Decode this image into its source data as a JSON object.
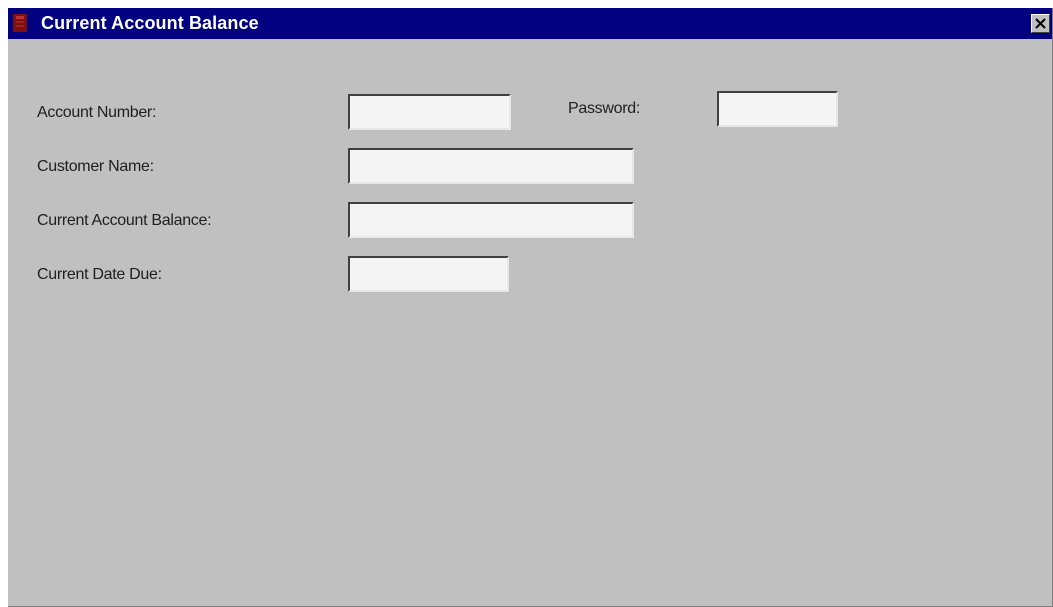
{
  "window": {
    "title": "Current Account Balance",
    "icon": "app-icon",
    "close_icon": "close-icon"
  },
  "form": {
    "account_number": {
      "label": "Account Number:",
      "value": ""
    },
    "password": {
      "label": "Password:",
      "value": ""
    },
    "customer_name": {
      "label": "Customer Name:",
      "value": ""
    },
    "current_account_balance": {
      "label": "Current Account Balance:",
      "value": ""
    },
    "current_date_due": {
      "label": "Current Date Due:",
      "value": ""
    }
  },
  "colors": {
    "titlebar": "#000080",
    "window_bg": "#c0c0c0",
    "field_bg": "#f4f4f4"
  }
}
